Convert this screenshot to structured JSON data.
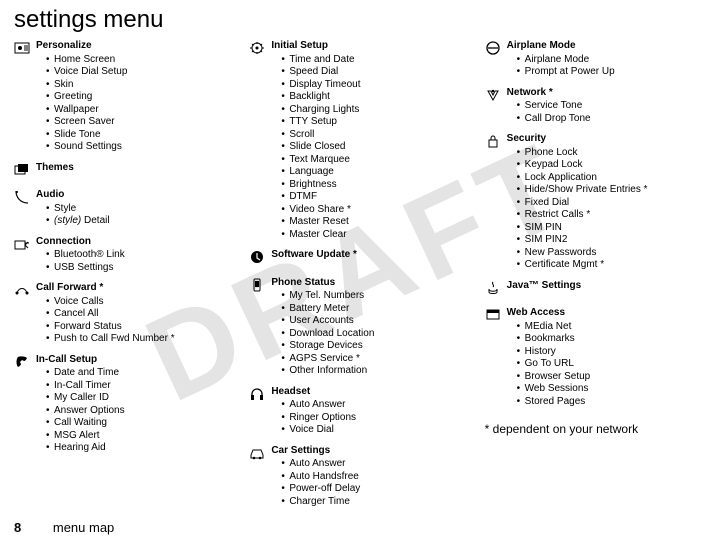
{
  "title": "settings menu",
  "watermark": "DRAFT",
  "footnote": "* dependent on your network",
  "page_number": "8",
  "footer_label": "menu map",
  "columns": [
    [
      {
        "heading": "Personalize",
        "icon": "personalize-icon",
        "items": [
          "Home Screen",
          "Voice Dial Setup",
          "Skin",
          "Greeting",
          "Wallpaper",
          "Screen Saver",
          "Slide Tone",
          "Sound Settings"
        ]
      },
      {
        "heading": "Themes",
        "icon": "themes-icon",
        "items": []
      },
      {
        "heading": "Audio",
        "icon": "audio-icon",
        "items": [
          "Style",
          "(style) Detail"
        ],
        "italic_idx": 1
      },
      {
        "heading": "Connection",
        "icon": "connection-icon",
        "items": [
          "Bluetooth® Link",
          "USB Settings"
        ]
      },
      {
        "heading": "Call Forward *",
        "icon": "call-forward-icon",
        "items": [
          "Voice Calls",
          "Cancel All",
          "Forward Status",
          "Push to Call Fwd Number *"
        ]
      },
      {
        "heading": "In-Call Setup",
        "icon": "incall-icon",
        "items": [
          "Date and Time",
          "In-Call Timer",
          "My Caller ID",
          "Answer Options",
          "Call Waiting",
          "MSG Alert",
          "Hearing Aid"
        ]
      }
    ],
    [
      {
        "heading": "Initial Setup",
        "icon": "initial-setup-icon",
        "items": [
          "Time and Date",
          "Speed Dial",
          "Display Timeout",
          "Backlight",
          "Charging Lights",
          "TTY Setup",
          "Scroll",
          "Slide Closed",
          "Text Marquee",
          "Language",
          "Brightness",
          "DTMF",
          "Video Share *",
          "Master Reset",
          "Master Clear"
        ]
      },
      {
        "heading": "Software Update *",
        "icon": "software-update-icon",
        "items": []
      },
      {
        "heading": "Phone Status",
        "icon": "phone-status-icon",
        "items": [
          "My Tel. Numbers",
          "Battery Meter",
          "User Accounts",
          "Download Location",
          "Storage Devices",
          "AGPS Service *",
          "Other Information"
        ]
      },
      {
        "heading": "Headset",
        "icon": "headset-icon",
        "items": [
          "Auto Answer",
          "Ringer Options",
          "Voice Dial"
        ]
      },
      {
        "heading": "Car Settings",
        "icon": "car-icon",
        "items": [
          "Auto Answer",
          "Auto Handsfree",
          "Power-off Delay",
          "Charger Time"
        ]
      }
    ],
    [
      {
        "heading": "Airplane Mode",
        "icon": "airplane-icon",
        "items": [
          "Airplane Mode",
          "Prompt at Power Up"
        ]
      },
      {
        "heading": "Network *",
        "icon": "network-icon",
        "items": [
          "Service Tone",
          "Call Drop Tone"
        ]
      },
      {
        "heading": "Security",
        "icon": "security-icon",
        "items": [
          "Phone Lock",
          "Keypad Lock",
          "Lock Application",
          "Hide/Show Private Entries *",
          "Fixed Dial",
          "Restrict Calls *",
          "SIM PIN",
          "SIM PIN2",
          "New Passwords",
          "Certificate Mgmt *"
        ]
      },
      {
        "heading": "Java™ Settings",
        "icon": "java-icon",
        "items": []
      },
      {
        "heading": "Web Access",
        "icon": "web-icon",
        "items": [
          "MEdia Net",
          "Bookmarks",
          "History",
          "Go To URL",
          "Browser Setup",
          "Web Sessions",
          "Stored Pages"
        ]
      }
    ]
  ]
}
